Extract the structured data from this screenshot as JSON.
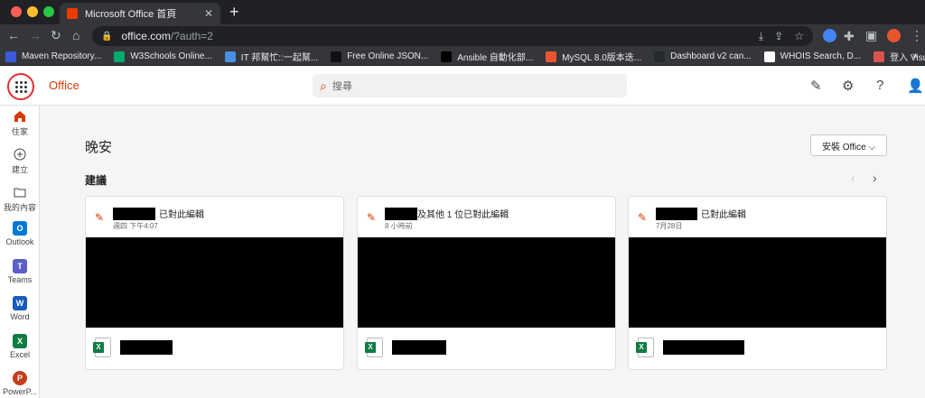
{
  "browser": {
    "tab_title": "Microsoft Office 首頁",
    "close_glyph": "✕",
    "newtab_glyph": "+",
    "url_host": "office.com",
    "url_path": "/?auth=2",
    "bookmarks": [
      {
        "label": "Maven Repository...",
        "color": "#3b5bdb"
      },
      {
        "label": "W3Schools Online...",
        "color": "#04aa6d"
      },
      {
        "label": "IT 邦幫忙::一起幫...",
        "color": "#4a90e2"
      },
      {
        "label": "Free Online JSON...",
        "color": "#111111"
      },
      {
        "label": "Ansible 自動化部...",
        "color": "#000000"
      },
      {
        "label": "MySQL 8.0版本迭...",
        "color": "#e8552f"
      },
      {
        "label": "Dashboard v2 can...",
        "color": "#24292e"
      },
      {
        "label": "WHOIS Search, D...",
        "color": "#ffffff"
      },
      {
        "label": "登入 Visual Paradi...",
        "color": "#d9534f"
      }
    ],
    "bookmarks_more": "»"
  },
  "header": {
    "brand": "Office",
    "search_placeholder": "搜尋",
    "help_glyph": "?"
  },
  "rail": [
    {
      "label": "住家",
      "icon": "home-icon",
      "color": "#d83b01"
    },
    {
      "label": "建立",
      "icon": "plus-circle-icon",
      "color": "#ffffff"
    },
    {
      "label": "我的內容",
      "icon": "folder-icon",
      "color": "#ffffff"
    },
    {
      "label": "Outlook",
      "icon": "outlook-icon",
      "color": "#0078d4",
      "letter": "O"
    },
    {
      "label": "Teams",
      "icon": "teams-icon",
      "color": "#5b5fc7",
      "letter": "T"
    },
    {
      "label": "Word",
      "icon": "word-icon",
      "color": "#185abd",
      "letter": "W"
    },
    {
      "label": "Excel",
      "icon": "excel-icon",
      "color": "#107c41",
      "letter": "X"
    },
    {
      "label": "PowerP...",
      "icon": "powerpoint-icon",
      "color": "#c43e1c",
      "letter": "P"
    }
  ],
  "main": {
    "greeting": "晚安",
    "install_label": "安裝 Office ⌵",
    "section_title": "建議",
    "pager_prev": "‹",
    "pager_next": "›",
    "cards": [
      {
        "title": "已對此編輯",
        "meta": "週四 下午4:07"
      },
      {
        "title": "及其他 1 位已對此編輯",
        "meta": "8 小時前"
      },
      {
        "title": "已對此編輯",
        "meta": "7月28日"
      }
    ]
  }
}
